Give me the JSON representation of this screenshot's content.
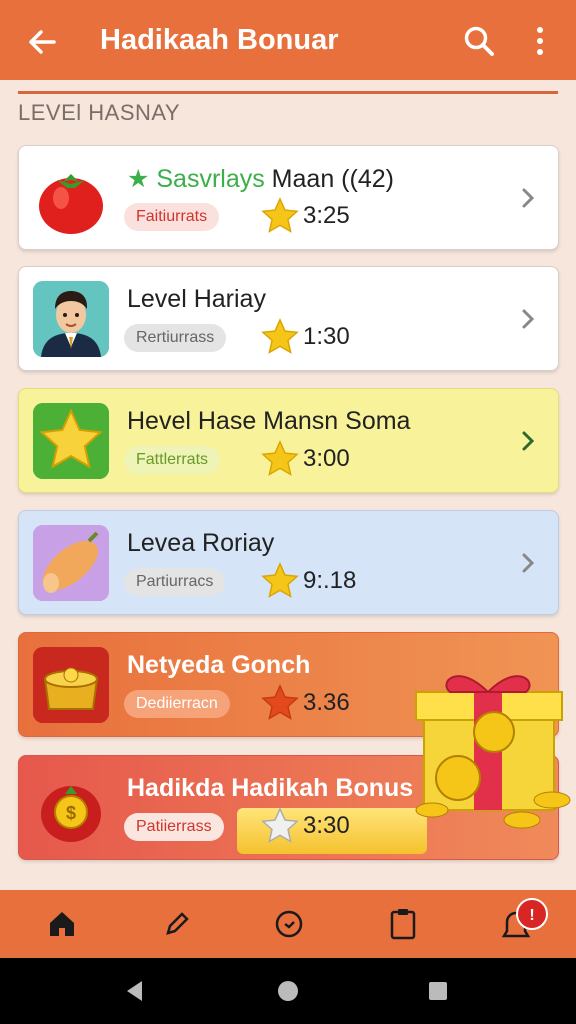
{
  "app_bar": {
    "title": "Hadikaah Bonuar",
    "back_icon": "arrow-left-icon",
    "search_icon": "search-icon",
    "menu_icon": "more-vert-icon",
    "color": "#e8703c"
  },
  "section": {
    "title": "LEVEl HASNAY"
  },
  "cards": [
    {
      "title_prefix": "Sasvrlays",
      "title_rest": " Maan ((42)",
      "tag": "Faitiurrats",
      "score": "3:25",
      "thumb_icon": "tomato-icon",
      "chevron": "chevron-right-icon"
    },
    {
      "title": "Level Hariay",
      "tag": "Rertiurrass",
      "score": "1:30",
      "thumb_icon": "avatar-man-icon",
      "chevron": "chevron-right-icon"
    },
    {
      "title": "Hevel Hase Mansn Soma",
      "tag": "Fattlerrats",
      "score": "3:00",
      "thumb_icon": "star-badge-icon",
      "chevron": "chevron-right-icon"
    },
    {
      "title": "Levea Roriay",
      "tag": "Partiurracs",
      "score": "9:.18",
      "thumb_icon": "sweet-potato-icon",
      "chevron": "chevron-right-icon"
    },
    {
      "title": "Netyeda Gonch",
      "tag": "Dediierracn",
      "score": "3.36",
      "thumb_icon": "gold-pot-icon"
    },
    {
      "title": "Hadikda Hadikah Bonus",
      "tag": "Patiierrass",
      "score": "3:30",
      "thumb_icon": "coin-apple-icon"
    }
  ],
  "bottom_nav": {
    "items": [
      "home-icon",
      "edit-icon",
      "clock-icon",
      "clipboard-icon",
      "notifications-icon"
    ],
    "badge": "!"
  },
  "system_nav": [
    "back-triangle-icon",
    "home-circle-icon",
    "recents-square-icon"
  ]
}
